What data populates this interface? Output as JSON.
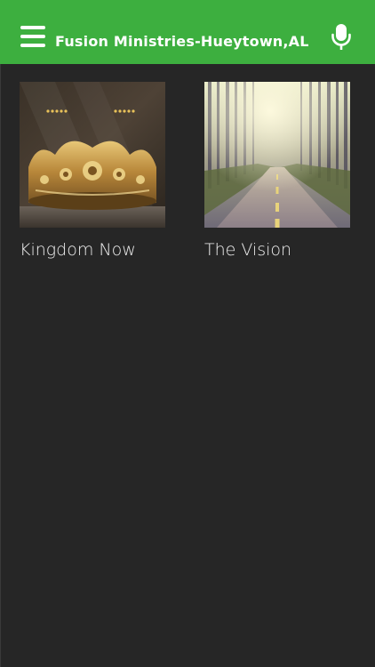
{
  "header": {
    "title": "Fusion Ministries-Hueytown,AL",
    "menu_icon": "hamburger-menu-icon",
    "mic_icon": "microphone-icon",
    "background_color": "#3daf3f"
  },
  "content": {
    "background_color": "#262626",
    "tiles": [
      {
        "label": "Kingdom Now",
        "image": "golden-crown-image"
      },
      {
        "label": "The Vision",
        "image": "forest-road-image"
      }
    ]
  }
}
